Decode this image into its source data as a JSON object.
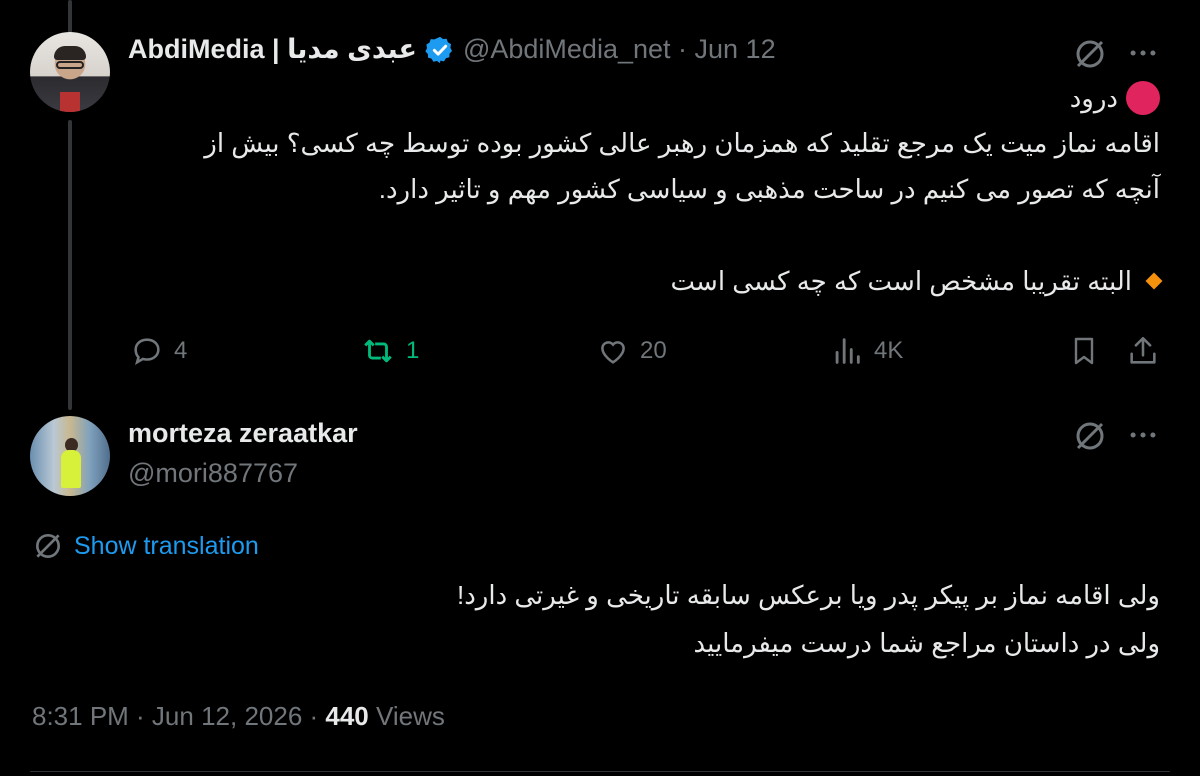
{
  "original_tweet": {
    "author_name": "AbdiMedia | عبدی مدیا",
    "handle": "@AbdiMedia_net",
    "date": "Jun 12",
    "greeting": "درود",
    "body_line1": "اقامه نماز میت یک مرجع تقلید که همزمان رهبر عالی کشور بوده توسط چه کسی؟ بیش از",
    "body_line2": "آنچه که تصور می کنیم در ساحت مذهبی و سیاسی کشور مهم و تاثیر دارد.",
    "note": "البته تقریبا مشخص است که چه کسی است",
    "stats": {
      "replies": "4",
      "retweets": "1",
      "likes": "20",
      "views": "4K"
    }
  },
  "reply": {
    "author_name": "morteza zeraatkar",
    "handle": "@mori887767",
    "show_translation": "Show translation",
    "body_line1": "ولی اقامه نماز بر پیکر پدر ویا برعکس سابقه تاریخی و غیرتی دارد!",
    "body_line2": "ولی در داستان مراجع شما درست میفرمایید",
    "timestamp": "8:31 PM · Jun 12, 2026 · ",
    "views_count": "440",
    "views_label": " Views"
  },
  "icons": {
    "grok": "grok-icon",
    "more": "more-icon",
    "reply": "reply-icon",
    "retweet": "retweet-icon",
    "like": "heart-icon",
    "views": "analytics-icon",
    "bookmark": "bookmark-icon",
    "share": "share-icon",
    "verified": "verified-badge-icon",
    "translate": "translate-icon"
  },
  "colors": {
    "link": "#1d9bf0",
    "retweet": "#00ba7c",
    "muted": "#71767b",
    "red_dot": "#e0245e",
    "diamond": "#f4900c"
  }
}
